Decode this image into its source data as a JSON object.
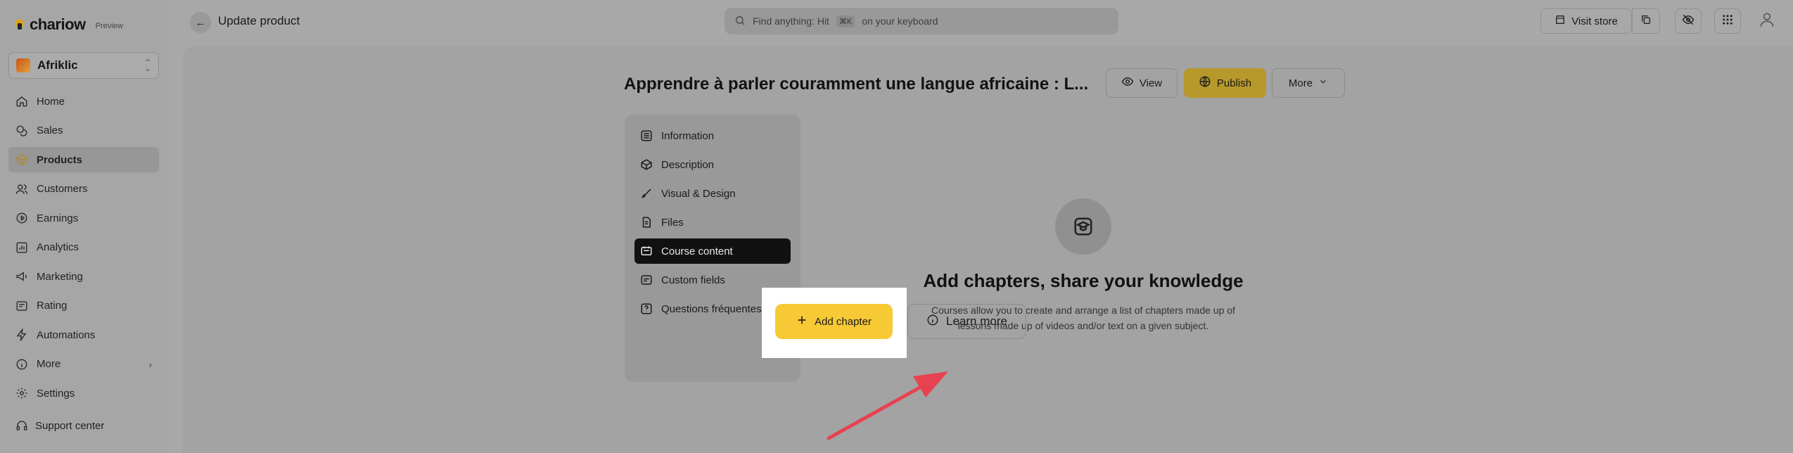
{
  "brand": {
    "name": "chariow",
    "tag": "Preview"
  },
  "store": {
    "name": "Afriklic"
  },
  "sidebar": {
    "items": [
      {
        "label": "Home",
        "icon": "home-icon"
      },
      {
        "label": "Sales",
        "icon": "coins-icon"
      },
      {
        "label": "Products",
        "icon": "box-icon",
        "active": true
      },
      {
        "label": "Customers",
        "icon": "users-icon"
      },
      {
        "label": "Earnings",
        "icon": "earnings-icon"
      },
      {
        "label": "Analytics",
        "icon": "chart-icon"
      },
      {
        "label": "Marketing",
        "icon": "megaphone-icon"
      },
      {
        "label": "Rating",
        "icon": "rating-icon"
      },
      {
        "label": "Automations",
        "icon": "bolt-icon"
      },
      {
        "label": "More",
        "icon": "info-icon"
      },
      {
        "label": "Settings",
        "icon": "gear-icon"
      }
    ],
    "support": "Support center"
  },
  "topbar": {
    "title": "Update product",
    "search_placeholder": "Find anything: Hit",
    "search_kbd": "⌘K",
    "search_suffix": "on your keyboard",
    "visit_store": "Visit store"
  },
  "product": {
    "title": "Apprendre à parler couramment une langue africaine : L...",
    "view": "View",
    "publish": "Publish",
    "more": "More"
  },
  "tabs": [
    {
      "label": "Information",
      "icon": "list-icon"
    },
    {
      "label": "Description",
      "icon": "cube-icon"
    },
    {
      "label": "Visual & Design",
      "icon": "brush-icon"
    },
    {
      "label": "Files",
      "icon": "file-icon"
    },
    {
      "label": "Course content",
      "icon": "course-icon",
      "active": true
    },
    {
      "label": "Custom fields",
      "icon": "fields-icon"
    },
    {
      "label": "Questions fréquentes",
      "icon": "question-icon"
    }
  ],
  "empty_state": {
    "title": "Add chapters, share your knowledge",
    "line1": "Courses allow you to create and arrange a list of chapters made up of",
    "line2": "lessons made up of videos and/or text on a given subject.",
    "add_chapter": "Add chapter",
    "learn_more": "Learn more"
  },
  "colors": {
    "accent": "#f7c935",
    "arrow": "#e8414f",
    "active_tab": "#111111"
  }
}
